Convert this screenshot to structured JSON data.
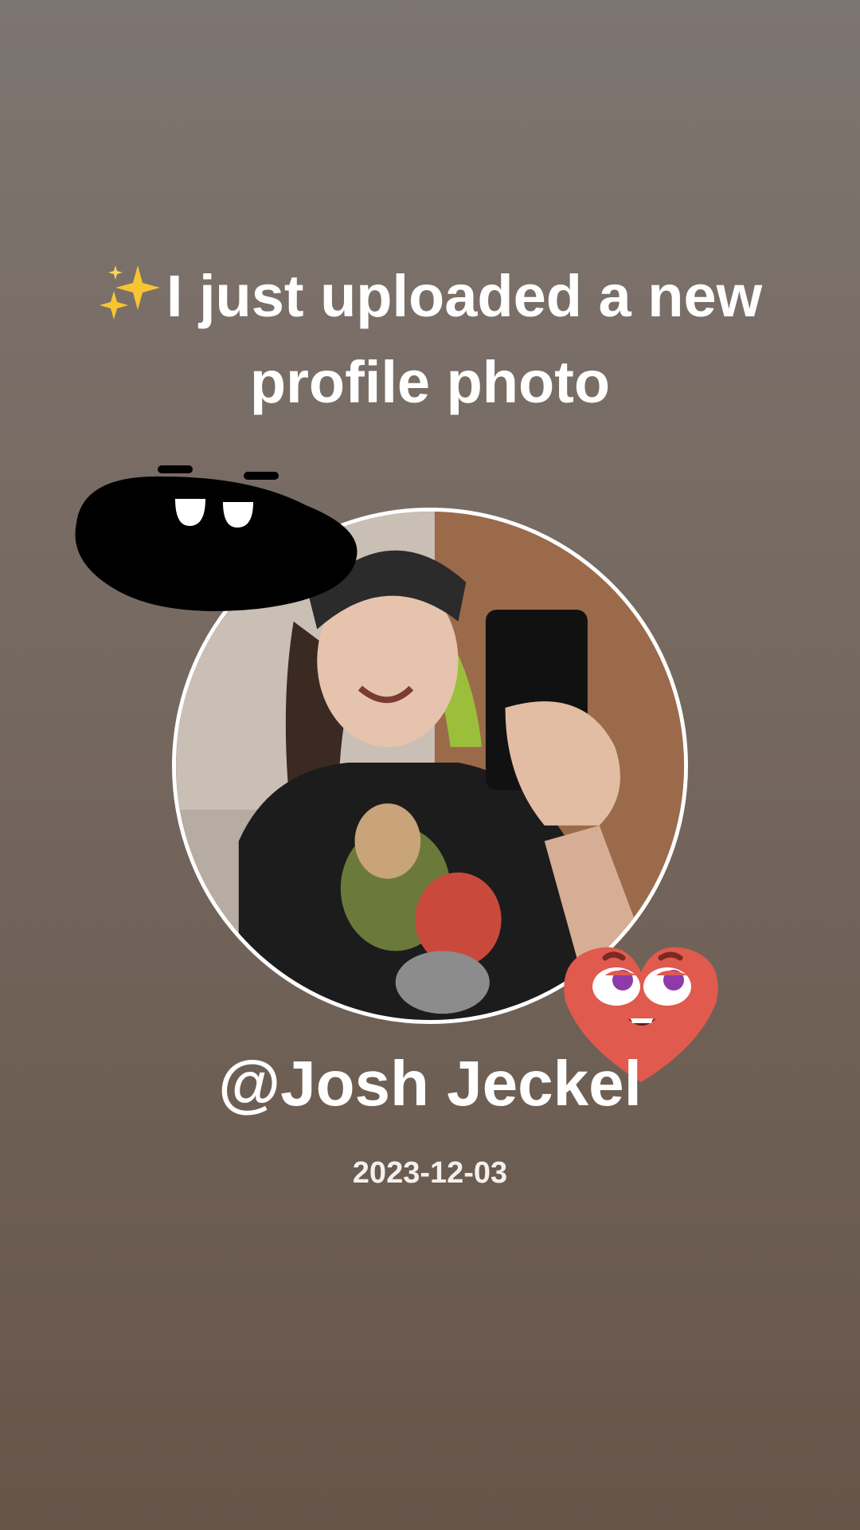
{
  "post": {
    "sparkle_icon": "sparkles-icon",
    "headline": "I just uploaded a new profile photo",
    "username": "@Josh Jeckel",
    "date": "2023-12-03"
  },
  "stickers": {
    "top_left": "smiling-blob-sticker",
    "bottom_right": "heart-face-sticker"
  },
  "colors": {
    "background_top": "#7d7570",
    "background_bottom": "#665549",
    "text": "#ffffff",
    "heart": "#e05a4e"
  }
}
